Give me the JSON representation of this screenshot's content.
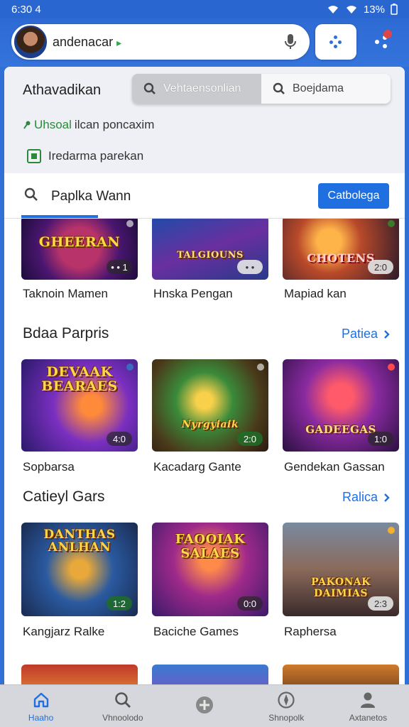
{
  "status_bar": {
    "time": "6:30 4",
    "battery": "13%"
  },
  "topbar": {
    "account_name": "andenacar",
    "account_caret": "▸"
  },
  "filters": {
    "title": "Athavadikan",
    "segment_active": "Vehtaensonlian",
    "segment_inactive": "Boejdama",
    "check_green": "Uhsoal",
    "check_text": "ilcan poncaxim",
    "checkbox_label": "Iredarma parekan"
  },
  "search": {
    "query": "Paplka Wann",
    "categories_button": "Catbolega"
  },
  "top_row": [
    {
      "title": "Taknoin Mamen",
      "art_text": "GHEERAN",
      "badge": "• • 1"
    },
    {
      "title": "Hnska Pengan",
      "art_text": "TALGIOUNS",
      "badge": "• •"
    },
    {
      "title": "Mapiad kan",
      "art_text": "CHOTENS",
      "badge": "2:0"
    }
  ],
  "section1": {
    "title": "Bdaa Parpris",
    "see_all": "Patiea",
    "games": [
      {
        "title": "Sopbarsa",
        "art_text": "DEVAAK BEARAES",
        "badge": "4:0"
      },
      {
        "title": "Kacadarg Gante",
        "art_text": "Nyrgyiaik",
        "badge": "2:0"
      },
      {
        "title": "Gendekan Gassan",
        "art_text": "GADEEGAS",
        "badge": "1:0"
      }
    ]
  },
  "section2": {
    "title": "Catieyl Gars",
    "see_all": "Ralica",
    "games": [
      {
        "title": "Kangjarz Ralke",
        "art_text": "DANTHAS ANLHAN",
        "badge": "1:2"
      },
      {
        "title": "Baciche Games",
        "art_text": "FAOOIAK SALAES",
        "badge": "0:0"
      },
      {
        "title": "Raphersa",
        "art_text": "PAKONAK DAIMIAS",
        "badge": "2:3"
      }
    ]
  },
  "bottom_nav": [
    {
      "label": "Haaho",
      "icon": "home-icon"
    },
    {
      "label": "Vhnoolodo",
      "icon": "search-icon"
    },
    {
      "label": "",
      "icon": "add-circle-icon"
    },
    {
      "label": "Shnopolk",
      "icon": "compass-icon"
    },
    {
      "label": "Axtanetos",
      "icon": "person-icon"
    }
  ]
}
